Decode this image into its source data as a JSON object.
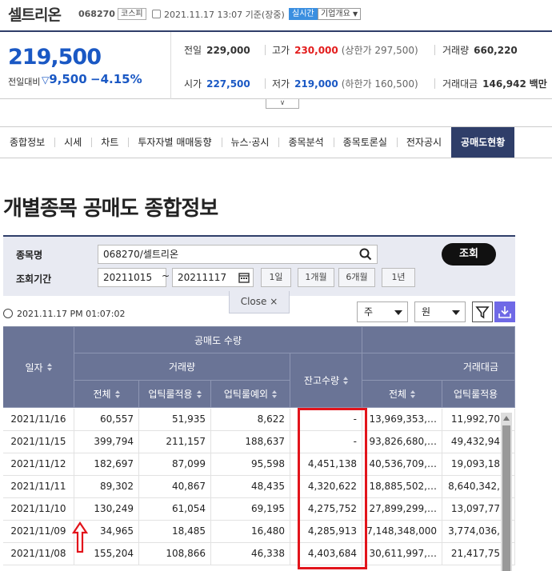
{
  "header": {
    "stock_name": "셀트리온",
    "stock_code": "068270",
    "market": "코스피",
    "date_basis": "2021.11.17 13:07 기준(장중)",
    "realtime": "실시간",
    "company_info": "기업개요"
  },
  "price": {
    "current": "219,500",
    "change_label": "전일대비",
    "change": "9,500",
    "change_pct": "−4.15%",
    "prev_label": "전일",
    "prev": "229,000",
    "high_label": "고가",
    "high": "230,000",
    "upper_limit": "(상한가 297,500)",
    "volume_label": "거래량",
    "volume": "660,220",
    "open_label": "시가",
    "open": "227,500",
    "low_label": "저가",
    "low": "219,000",
    "lower_limit": "(하한가 160,500)",
    "amount_label": "거래대금",
    "amount": "146,942",
    "amount_unit": "백만"
  },
  "tabs": [
    "종합정보",
    "시세",
    "차트",
    "투자자별 매매동향",
    "뉴스·공시",
    "종목분석",
    "종목토론실",
    "전자공시",
    "공매도현황"
  ],
  "page_title": "개별종목 공매도 종합정보",
  "search": {
    "name_label": "종목명",
    "name_value": "068270/셀트리온",
    "period_label": "조회기간",
    "from": "20211015",
    "sep": "~",
    "to": "20211117",
    "ranges": [
      "1일",
      "1개월",
      "6개월",
      "1년"
    ],
    "submit": "조회",
    "close": "Close ×"
  },
  "toolbar": {
    "timestamp": "2021.11.17 PM 01:07:02",
    "unit_select": "주",
    "currency_select": "원"
  },
  "table": {
    "col_date": "일자",
    "group_short": "공매도 수량",
    "group_volume": "거래량",
    "group_balance": "잔고수량",
    "group_amount": "거래대금",
    "col_total": "전체",
    "col_uptick": "업틱룰적용",
    "col_except": "업틱룰예외",
    "col_amount_total": "전체",
    "col_amount_uptick": "업틱룰적용",
    "rows": [
      {
        "date": "2021/11/16",
        "total": "60,557",
        "uptick": "51,935",
        "except": "8,622",
        "balance": "-",
        "amt_total": "13,969,353,…",
        "amt_uptick": "11,992,70…"
      },
      {
        "date": "2021/11/15",
        "total": "399,794",
        "uptick": "211,157",
        "except": "188,637",
        "balance": "-",
        "amt_total": "93,826,680,…",
        "amt_uptick": "49,432,94…"
      },
      {
        "date": "2021/11/12",
        "total": "182,697",
        "uptick": "87,099",
        "except": "95,598",
        "balance": "4,451,138",
        "amt_total": "40,536,709,…",
        "amt_uptick": "19,093,18…"
      },
      {
        "date": "2021/11/11",
        "total": "89,302",
        "uptick": "40,867",
        "except": "48,435",
        "balance": "4,320,622",
        "amt_total": "18,885,502,…",
        "amt_uptick": "8,640,342,…"
      },
      {
        "date": "2021/11/10",
        "total": "130,249",
        "uptick": "61,054",
        "except": "69,195",
        "balance": "4,275,752",
        "amt_total": "27,899,299,…",
        "amt_uptick": "13,097,77…"
      },
      {
        "date": "2021/11/09",
        "total": "34,965",
        "uptick": "18,485",
        "except": "16,480",
        "balance": "4,285,913",
        "amt_total": "7,148,348,000",
        "amt_uptick": "3,774,036,…"
      },
      {
        "date": "2021/11/08",
        "total": "155,204",
        "uptick": "108,866",
        "except": "46,338",
        "balance": "4,403,684",
        "amt_total": "30,611,997,…",
        "amt_uptick": "21,417,75…"
      }
    ]
  },
  "colors": {
    "accent": "#2f3e69",
    "down": "#1a58c4",
    "up": "#e31d1d",
    "highlight": "#e2141b"
  }
}
